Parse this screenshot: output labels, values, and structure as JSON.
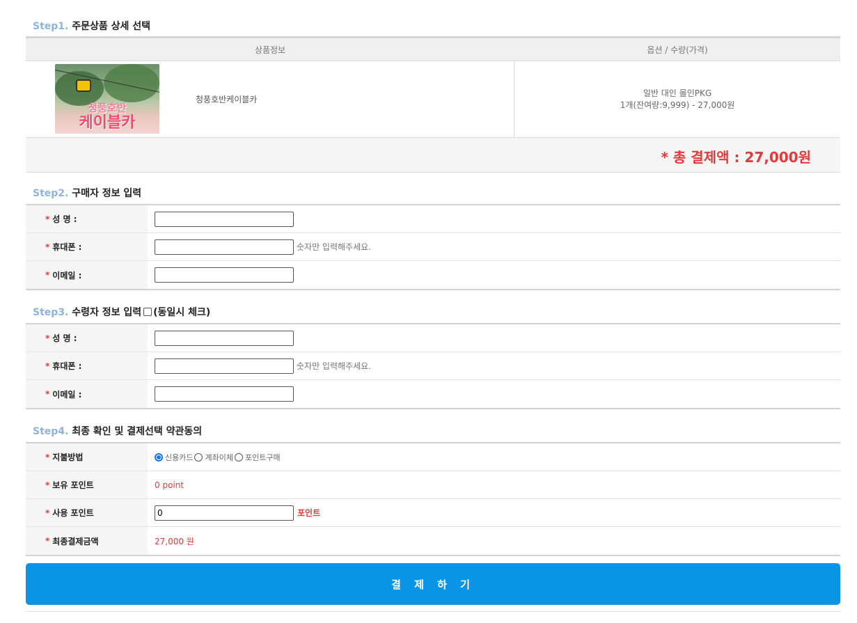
{
  "step1": {
    "no": "Step1.",
    "title": "주문상품 상세 선택",
    "col_product": "상품정보",
    "col_option": "옵션 / 수량(가격)",
    "product": {
      "image_text_1": "청풍호반",
      "image_text_2": "케이블카",
      "image_text_3": "",
      "name": "청풍호반케이블카",
      "option_line1": "일반 대인 몰인PKG",
      "option_line2": "1개(잔여량:9,999) - 27,000원"
    },
    "total": "* 총 결제액 : 27,000원"
  },
  "step2": {
    "no": "Step2.",
    "title": "구매자 정보 입력",
    "rows": [
      {
        "label": "성  명 :",
        "value": "",
        "hint": ""
      },
      {
        "label": "휴대폰 :",
        "value": "",
        "hint": "숫자만 입력해주세요."
      },
      {
        "label": "이메일 :",
        "value": "",
        "hint": ""
      }
    ]
  },
  "step3": {
    "no": "Step3.",
    "title": "수령자 정보 입력",
    "same_check_label": "(동일시 체크)",
    "rows": [
      {
        "label": "성  명 :",
        "value": "",
        "hint": ""
      },
      {
        "label": "휴대폰 :",
        "value": "",
        "hint": "숫자만 입력해주세요."
      },
      {
        "label": "이메일 :",
        "value": "",
        "hint": ""
      }
    ]
  },
  "step4": {
    "no": "Step4.",
    "title": "최종 확인 및 결제선택 약관동의",
    "payment_label": "지불방법",
    "payment_options": [
      "신용카드",
      "계좌이체",
      "포인트구매"
    ],
    "payment_selected": "신용카드",
    "owned_points_label": "보유 포인트",
    "owned_points_value": "0 point",
    "use_points_label": "사용 포인트",
    "use_points_value": "0",
    "use_points_unit": "포인트",
    "final_amount_label": "최종결제금액",
    "final_amount_value": "27,000 원"
  },
  "pay_button": "결 제 하 기",
  "colors": {
    "accent_blue": "#0a94e6",
    "alert_red": "#e53838",
    "step_blue": "#8fb4d9"
  }
}
